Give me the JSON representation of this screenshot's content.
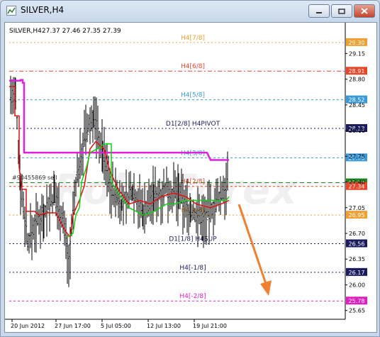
{
  "window": {
    "title": "SILVER,H4"
  },
  "chart_header": {
    "symbol": "SILVER,H4",
    "ohlc": "27.37 27.46 27.35 27.39"
  },
  "watermark": "RoboForex",
  "levels": [
    {
      "label": "H4[7/8]",
      "price": 29.3,
      "price_label": "29.30",
      "color": "#f0a030",
      "dash": "2,3"
    },
    {
      "label": "H4[6/8]",
      "price": 28.91,
      "price_label": "28.91",
      "color": "#e8452a",
      "dash": "6,3,2,3"
    },
    {
      "label": "H4[5/8]",
      "price": 28.52,
      "price_label": "28.52",
      "color": "#3a9ad9",
      "dash": "3,3"
    },
    {
      "label": "D1[2/8] H4PIVOT",
      "price": 28.13,
      "price_label": "28.13",
      "color": "#1a1a5e",
      "dash": "2,3"
    },
    {
      "label": "H4[3/8]",
      "price": 27.73,
      "price_label": "27.73",
      "color": "#3a9ad9",
      "dash": "3,3"
    },
    {
      "label": "",
      "price": 27.39,
      "price_label": "27.39",
      "color": "#1a8a1a",
      "dash": "6,4"
    },
    {
      "label": "H4[2/8]",
      "price": 27.34,
      "price_label": "27.34",
      "color": "#e8452a",
      "dash": "3,3"
    },
    {
      "label": "H4[1/8]",
      "price": 26.95,
      "price_label": "26.95",
      "color": "#f0a030",
      "dash": "2,3"
    },
    {
      "label": "D1[1/8] H4SUP",
      "price": 26.56,
      "price_label": "26.56",
      "color": "#1a1a5e",
      "dash": "2,3"
    },
    {
      "label": "H4[-1/8]",
      "price": 26.17,
      "price_label": "26.17",
      "color": "#1a1a5e",
      "dash": "2,3"
    },
    {
      "label": "H4[-2/8]",
      "price": 25.78,
      "price_label": "25.78",
      "color": "#e020c0",
      "dash": "3,3"
    }
  ],
  "order_label": "#90455869 sell",
  "y_ticks": [
    "29.15",
    "28.80",
    "28.45",
    "28.10",
    "27.75",
    "27.40",
    "27.05",
    "26.70",
    "26.35",
    "26.00",
    "25.65"
  ],
  "x_ticks": [
    "20 Jun 2012",
    "27 Jun 17:00",
    "5 Jul 05:00",
    "12 Jul 13:00",
    "19 Jul 21:00"
  ],
  "forecast": "down",
  "colors": {
    "bars": "#000000",
    "red_line": "#e01010",
    "green_line": "#10d010",
    "magenta_line": "#e020e0",
    "arrow": "#f08030"
  }
}
